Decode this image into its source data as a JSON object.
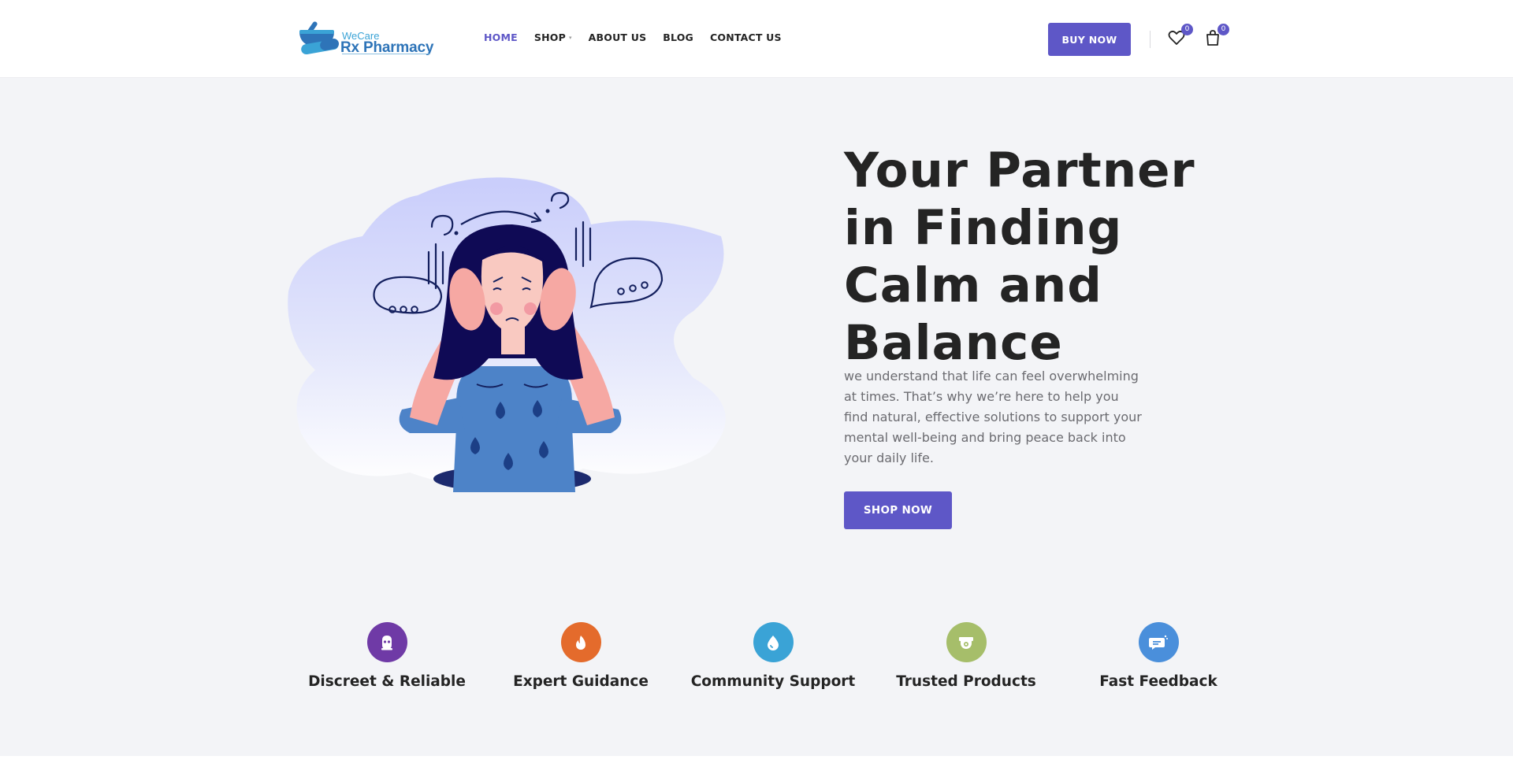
{
  "brand": {
    "name_top": "WeCare",
    "name_main": "Rx Pharmacy",
    "colors": {
      "accent": "#5e57c7",
      "logo_light": "#3aa3d6",
      "logo_dark": "#2e74b8"
    }
  },
  "nav": {
    "items": [
      {
        "label": "HOME",
        "active": true
      },
      {
        "label": "SHOP",
        "has_dropdown": true
      },
      {
        "label": "ABOUT US"
      },
      {
        "label": "BLOG"
      },
      {
        "label": "CONTACT US"
      }
    ]
  },
  "header": {
    "buy_label": "BUY NOW",
    "wishlist": {
      "icon": "heart-icon",
      "count": "0"
    },
    "cart": {
      "icon": "shopping-bag-icon",
      "count": "0"
    }
  },
  "hero": {
    "title": "Your Partner in Finding Calm and Balance",
    "description": "we understand that life can feel overwhelming at times. That’s why we’re here to help you find natural, effective solutions to support your mental well-being and bring peace back into your daily life.",
    "cta_label": "SHOP NOW",
    "illustration": "stressed-woman-illustration"
  },
  "features": [
    {
      "label": "Discreet & Reliable",
      "icon": "mask-icon",
      "color": "#6f3aa6"
    },
    {
      "label": "Expert Guidance",
      "icon": "flame-icon",
      "color": "#e46b2c"
    },
    {
      "label": "Community Support",
      "icon": "drop-icon",
      "color": "#3aa3d6"
    },
    {
      "label": "Trusted Products",
      "icon": "camera-icon",
      "color": "#a6be6a"
    },
    {
      "label": "Fast Feedback",
      "icon": "chat-icon",
      "color": "#4a8fdb"
    }
  ]
}
